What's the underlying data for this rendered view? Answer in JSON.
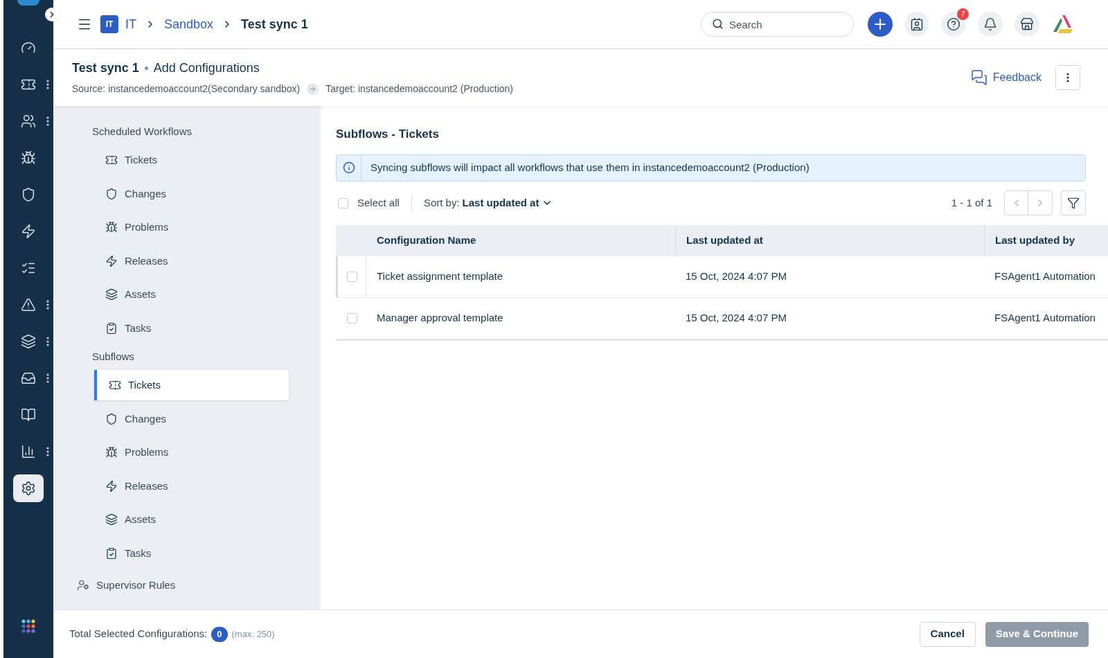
{
  "rail": {
    "items": [
      {
        "kind": "gauge",
        "selected": false,
        "has_menu": false
      },
      {
        "kind": "ticket",
        "selected": false,
        "has_menu": true
      },
      {
        "kind": "users",
        "selected": false,
        "has_menu": true
      },
      {
        "kind": "bug",
        "selected": false,
        "has_menu": false
      },
      {
        "kind": "shield",
        "selected": false,
        "has_menu": false
      },
      {
        "kind": "zap",
        "selected": false,
        "has_menu": false
      },
      {
        "kind": "list",
        "selected": false,
        "has_menu": false
      },
      {
        "kind": "alert",
        "selected": false,
        "has_menu": true
      },
      {
        "kind": "layers",
        "selected": false,
        "has_menu": true
      },
      {
        "kind": "inbox",
        "selected": false,
        "has_menu": true
      },
      {
        "kind": "book",
        "selected": false,
        "has_menu": false
      },
      {
        "kind": "chart",
        "selected": false,
        "has_menu": true
      },
      {
        "kind": "settings",
        "selected": true,
        "has_menu": false
      }
    ]
  },
  "topbar": {
    "workspace_badge": "IT",
    "breadcrumbs": [
      {
        "label": "IT",
        "link": true
      },
      {
        "label": "Sandbox",
        "link": true
      },
      {
        "label": "Test sync 1",
        "link": false
      }
    ],
    "search": {
      "placeholder": "Search"
    },
    "help_badge": "7"
  },
  "header": {
    "title": "Test sync 1",
    "subtitle": "Add Configurations",
    "source": "Source: instancedemoaccount2(Secondary sandbox)",
    "target": "Target: instancedemoaccount2 (Production)",
    "feedback": "Feedback"
  },
  "sidebar": {
    "groups": [
      {
        "label": "Scheduled Workflows",
        "items": [
          {
            "kind": "ticket",
            "label": "Tickets",
            "selected": false
          },
          {
            "kind": "shield",
            "label": "Changes",
            "selected": false
          },
          {
            "kind": "bug",
            "label": "Problems",
            "selected": false
          },
          {
            "kind": "zap",
            "label": "Releases",
            "selected": false
          },
          {
            "kind": "layers",
            "label": "Assets",
            "selected": false
          },
          {
            "kind": "clipboard",
            "label": "Tasks",
            "selected": false
          }
        ]
      },
      {
        "label": "Subflows",
        "items": [
          {
            "kind": "ticket",
            "label": "Tickets",
            "selected": true
          },
          {
            "kind": "shield",
            "label": "Changes",
            "selected": false
          },
          {
            "kind": "bug",
            "label": "Problems",
            "selected": false
          },
          {
            "kind": "zap",
            "label": "Releases",
            "selected": false
          },
          {
            "kind": "layers",
            "label": "Assets",
            "selected": false
          },
          {
            "kind": "clipboard",
            "label": "Tasks",
            "selected": false
          }
        ]
      }
    ],
    "extra": "Supervisor Rules"
  },
  "content": {
    "title": "Subflows - Tickets",
    "info": "Syncing subflows will impact all workflows that use them in instancedemoaccount2 (Production)",
    "select_all": {
      "label": "Select all",
      "checked": false
    },
    "sort_label": "Sort by:",
    "sort_value": "Last updated at",
    "pagination": "1 - 1 of 1",
    "table": {
      "columns": [
        "Configuration Name",
        "Last updated at",
        "Last updated by"
      ],
      "rows": [
        {
          "checked": false,
          "highlighted": true,
          "cells": [
            "Ticket assignment template",
            "15 Oct, 2024 4:07 PM",
            "FSAgent1 Automation"
          ]
        },
        {
          "checked": false,
          "highlighted": false,
          "cells": [
            "Manager approval template",
            "15 Oct, 2024 4:07 PM",
            "FSAgent1 Automation"
          ]
        }
      ]
    }
  },
  "footer": {
    "label": "Total Selected Configurations:",
    "count": "0",
    "max": "(max. 250)",
    "cancel": "Cancel",
    "save": {
      "label": "Save & Continue",
      "disabled": true
    }
  }
}
